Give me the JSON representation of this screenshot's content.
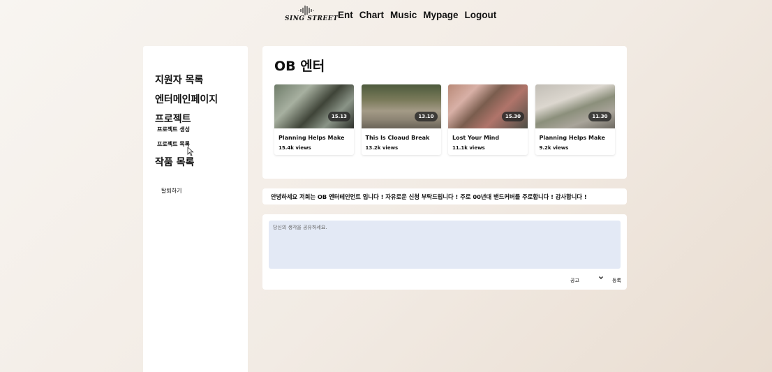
{
  "nav": {
    "logo_text": "SING STREET",
    "links": [
      "Ent",
      "Chart",
      "Music",
      "Mypage",
      "Logout"
    ]
  },
  "sidebar": {
    "applicants": "지원자 목록",
    "ent_main": "엔터메인페이지",
    "project": "프로젝트",
    "project_create": "프로젝트 생성",
    "project_list": "프로젝트 목록",
    "works": "작품 목록",
    "withdraw": "탈퇴하기"
  },
  "main": {
    "title": "OB 엔터",
    "videos": [
      {
        "title": "Planning Helps Make",
        "views": "15.4k views",
        "duration": "15.13"
      },
      {
        "title": "This Is Cloaud Break",
        "views": "13.2k views",
        "duration": "13.10"
      },
      {
        "title": "Lost Your Mind",
        "views": "11.1k views",
        "duration": "15.30"
      },
      {
        "title": "Planning Helps Make",
        "views": "9.2k views",
        "duration": "11.30"
      }
    ]
  },
  "notice": "안녕하세요 저희는 OB 엔터테인먼트 입니다 ! 자유로운 신청 부탁드립니다 ! 주로 00년대 밴드커버를 주로합니다 ! 감사합니다 !",
  "comment": {
    "placeholder": "당신의 생각을 공유하세요.",
    "category": "공고",
    "submit": "등록"
  },
  "colors": {
    "background": "#f2ebe4",
    "card": "#ffffff",
    "textarea": "#e3e9f5"
  }
}
